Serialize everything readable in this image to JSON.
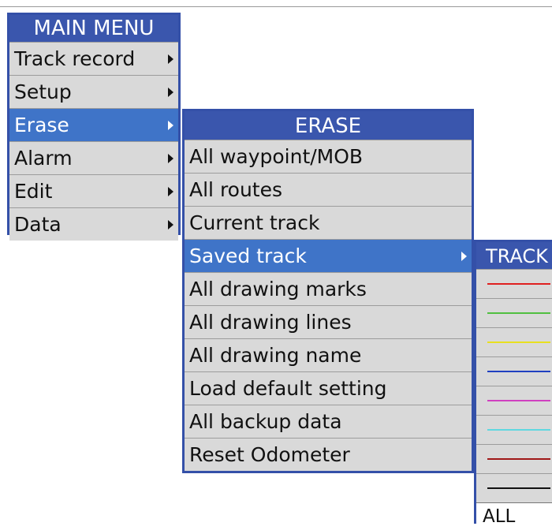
{
  "main_menu": {
    "title": "MAIN MENU",
    "items": [
      {
        "label": "Track record",
        "has_submenu": true,
        "selected": false
      },
      {
        "label": "Setup",
        "has_submenu": true,
        "selected": false
      },
      {
        "label": "Erase",
        "has_submenu": true,
        "selected": true
      },
      {
        "label": "Alarm",
        "has_submenu": true,
        "selected": false
      },
      {
        "label": "Edit",
        "has_submenu": true,
        "selected": false
      },
      {
        "label": "Data",
        "has_submenu": true,
        "selected": false
      }
    ]
  },
  "erase_menu": {
    "title": "ERASE",
    "items": [
      {
        "label": "All waypoint/MOB",
        "has_submenu": false,
        "selected": false
      },
      {
        "label": "All routes",
        "has_submenu": false,
        "selected": false
      },
      {
        "label": "Current track",
        "has_submenu": false,
        "selected": false
      },
      {
        "label": "Saved track",
        "has_submenu": true,
        "selected": true
      },
      {
        "label": "All drawing marks",
        "has_submenu": false,
        "selected": false
      },
      {
        "label": "All drawing lines",
        "has_submenu": false,
        "selected": false
      },
      {
        "label": "All drawing name",
        "has_submenu": false,
        "selected": false
      },
      {
        "label": "Load default setting",
        "has_submenu": false,
        "selected": false
      },
      {
        "label": "All backup data",
        "has_submenu": false,
        "selected": false
      },
      {
        "label": "Reset Odometer",
        "has_submenu": false,
        "selected": false
      }
    ]
  },
  "track_menu": {
    "title": "TRACK",
    "colors": [
      "#e02020",
      "#50c040",
      "#e8e020",
      "#2040c0",
      "#d040c0",
      "#60d8e0",
      "#a01818",
      "#111111"
    ],
    "all_label": "ALL"
  }
}
